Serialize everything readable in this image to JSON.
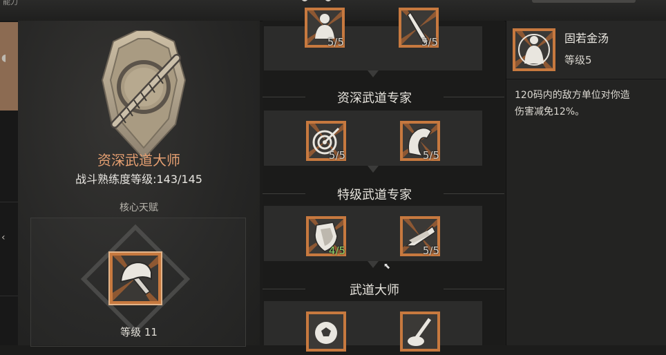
{
  "topbar": {
    "left_text": "能力"
  },
  "left": {
    "title": "资深武道大师",
    "proficiency_label": "战斗熟练度等级:143/145",
    "core_label": "核心天赋",
    "core_level": "等级 11"
  },
  "tiers": [
    {
      "label": "",
      "nodes": [
        {
          "icon": "figure-icon",
          "count": "5/5"
        },
        {
          "icon": "blade-icon",
          "count": "5/5"
        }
      ]
    },
    {
      "label": "资深武道专家",
      "nodes": [
        {
          "icon": "target-icon",
          "count": "5/5"
        },
        {
          "icon": "axe-icon",
          "count": "5/5"
        }
      ]
    },
    {
      "label": "特级武道专家",
      "nodes": [
        {
          "icon": "shield-icon",
          "count": "4/5"
        },
        {
          "icon": "wing-icon",
          "count": "5/5"
        }
      ]
    },
    {
      "label": "武道大师",
      "nodes": [
        {
          "icon": "ball-icon",
          "count": ""
        },
        {
          "icon": "sword-icon",
          "count": ""
        }
      ]
    }
  ],
  "detail": {
    "name": "固若金汤",
    "level": "等级5",
    "description": "120码内的敌方单位对你造\n伤害减免12%。"
  },
  "colors": {
    "accent": "#e6a072",
    "frame": "#c7793f",
    "partial": "#8fd36b"
  }
}
